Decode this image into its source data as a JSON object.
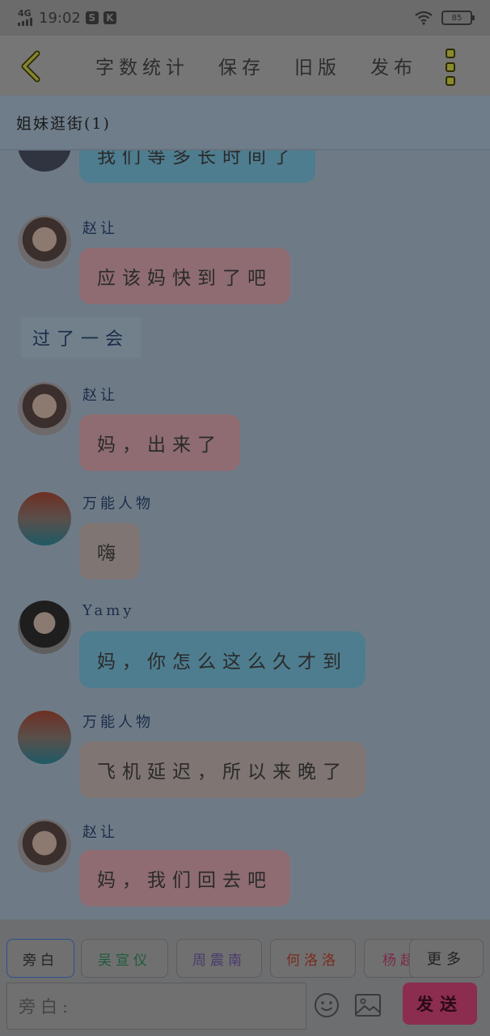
{
  "status_bar": {
    "network": "4G",
    "time": "19:02",
    "icon1": "S",
    "icon2": "K",
    "battery": "85"
  },
  "toolbar": {
    "back_icon": "chevron-left-icon",
    "actions": [
      "字数统计",
      "保存",
      "旧版",
      "发布"
    ],
    "menu_icon": "more-vertical-icon"
  },
  "chat": {
    "title": "姐妹逛街(1)",
    "messages": [
      {
        "type": "bubble",
        "sender": "",
        "text": "我们等多长时间了",
        "color": "blue"
      },
      {
        "type": "bubble",
        "sender": "赵让",
        "text": "应该妈快到了吧",
        "color": "pink"
      },
      {
        "type": "narration",
        "text": "过了一会"
      },
      {
        "type": "bubble",
        "sender": "赵让",
        "text": "妈，出来了",
        "color": "pink"
      },
      {
        "type": "bubble",
        "sender": "万能人物",
        "text": "嗨",
        "color": "tan"
      },
      {
        "type": "bubble",
        "sender": "Yamy",
        "text": "妈，你怎么这么久才到",
        "color": "blue"
      },
      {
        "type": "bubble",
        "sender": "万能人物",
        "text": "飞机延迟，所以来晚了",
        "color": "tan"
      },
      {
        "type": "bubble",
        "sender": "赵让",
        "text": "妈，我们回去吧",
        "color": "pink"
      }
    ]
  },
  "bottom": {
    "chips": [
      "旁白",
      "吴宣仪",
      "周震南",
      "何洛洛",
      "杨超"
    ],
    "chip_colors": [
      "#222222",
      "#1f5a3a",
      "#4a3a6e",
      "#7a2a1e",
      "#7a2a4a"
    ],
    "more_label": "更多",
    "input_placeholder": "旁白:",
    "send_label": "发送"
  }
}
